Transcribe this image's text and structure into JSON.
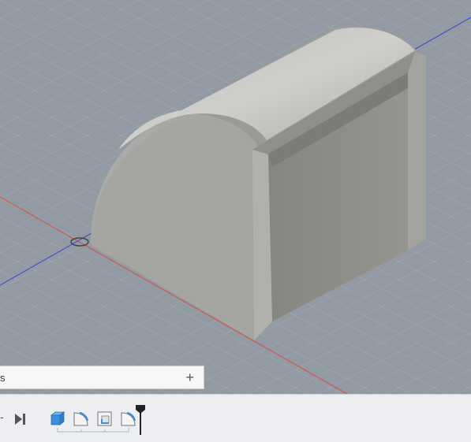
{
  "browser_panel": {
    "label": "s",
    "add_symbol": "+"
  },
  "timeline": {
    "prev_symbol": "-",
    "features": [
      {
        "name": "extrude-feature",
        "icon": "extrude-icon"
      },
      {
        "name": "fillet-feature",
        "icon": "fillet-icon"
      },
      {
        "name": "shell-feature",
        "icon": "shell-icon"
      },
      {
        "name": "fillet-feature-2",
        "icon": "fillet-icon"
      }
    ]
  },
  "colors": {
    "grid_background": "#929aa3",
    "grid_line": "#a7aeb6",
    "x_axis": "#d9534f",
    "y_axis": "#3d4fd6",
    "body_face": "#9c9c97",
    "accent": "#3a8ee0"
  }
}
